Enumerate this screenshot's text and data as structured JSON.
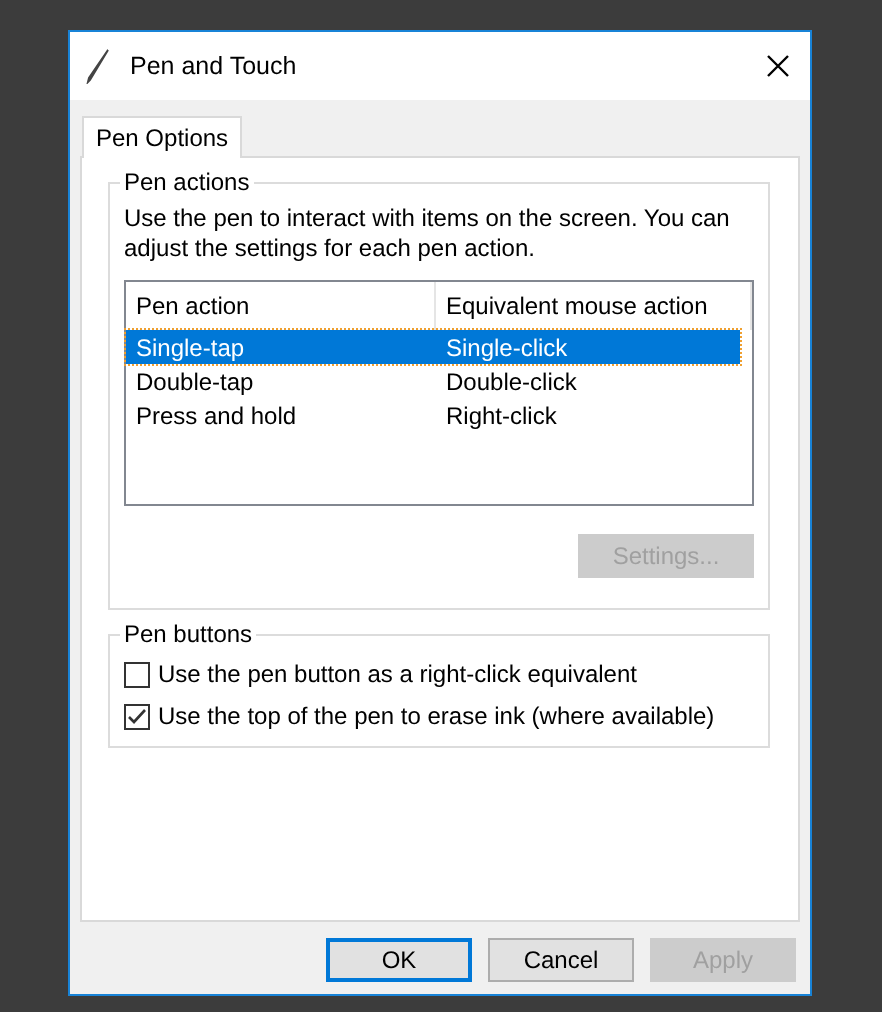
{
  "window": {
    "title": "Pen and Touch"
  },
  "tabs": [
    {
      "label": "Pen Options",
      "selected": true
    }
  ],
  "pen_actions": {
    "title": "Pen actions",
    "description": "Use the pen to interact with items on the screen.  You can adjust the settings for each pen action.",
    "columns": [
      "Pen action",
      "Equivalent mouse action"
    ],
    "rows": [
      {
        "pen_action": "Single-tap",
        "mouse_action": "Single-click",
        "selected": true
      },
      {
        "pen_action": "Double-tap",
        "mouse_action": "Double-click",
        "selected": false
      },
      {
        "pen_action": "Press and hold",
        "mouse_action": "Right-click",
        "selected": false
      }
    ],
    "settings_button": {
      "label": "Settings...",
      "disabled": true
    }
  },
  "pen_buttons": {
    "title": "Pen buttons",
    "options": [
      {
        "label": "Use the pen button as a right-click equivalent",
        "checked": false
      },
      {
        "label": "Use the top of the pen to erase ink (where available)",
        "checked": true
      }
    ]
  },
  "buttons": [
    {
      "label": "OK",
      "default": true,
      "disabled": false
    },
    {
      "label": "Cancel",
      "default": false,
      "disabled": false
    },
    {
      "label": "Apply",
      "default": false,
      "disabled": true
    }
  ]
}
